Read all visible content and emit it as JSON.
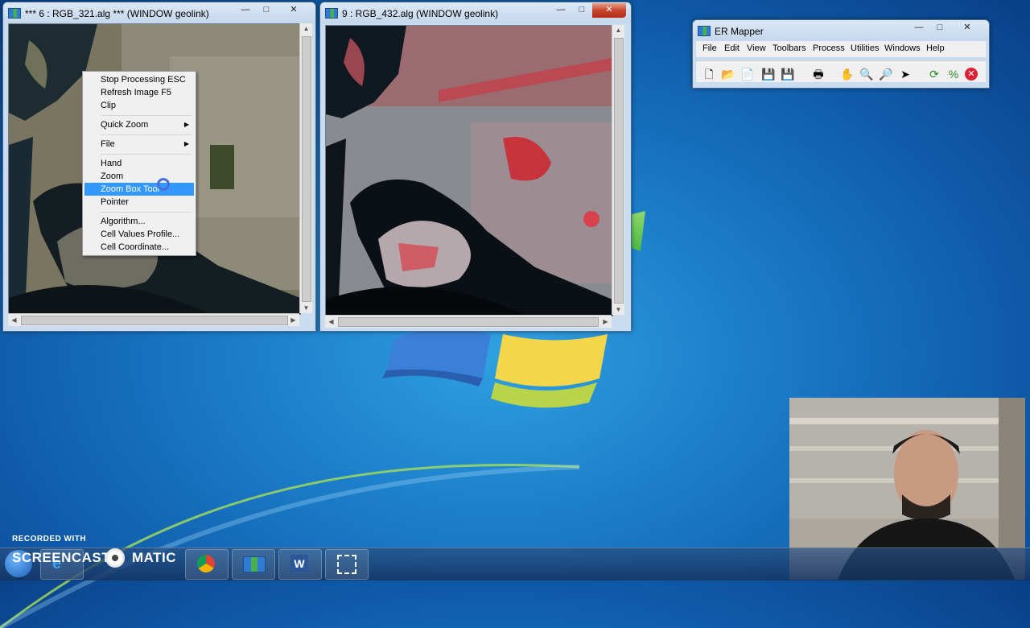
{
  "windows": {
    "left": {
      "title": "*** 6 : RGB_321.alg *** (WINDOW geolink)",
      "minimize": "—",
      "maximize": "□",
      "close": "✕"
    },
    "right": {
      "title": "9 : RGB_432.alg (WINDOW geolink)",
      "minimize": "—",
      "maximize": "□",
      "close": "✕"
    }
  },
  "context_menu": {
    "items": [
      {
        "label": "Stop Processing ESC"
      },
      {
        "label": "Refresh Image F5"
      },
      {
        "label": "Clip"
      },
      {
        "label": "Quick Zoom"
      },
      {
        "label": "File"
      },
      {
        "label": "Hand"
      },
      {
        "label": "Zoom"
      },
      {
        "label": "Zoom Box Tool"
      },
      {
        "label": "Pointer"
      },
      {
        "label": "Algorithm..."
      },
      {
        "label": "Cell Values Profile..."
      },
      {
        "label": "Cell Coordinate..."
      }
    ],
    "submenu_arrow": "▶",
    "selected": "Zoom Box Tool"
  },
  "ermapper": {
    "title": "ER Mapper",
    "menu": [
      "File",
      "Edit",
      "View",
      "Toolbars",
      "Process",
      "Utilities",
      "Windows",
      "Help"
    ],
    "minimize": "—",
    "maximize": "□",
    "close": "✕",
    "toolbar_icons": [
      "new-icon",
      "open-icon",
      "copy-icon",
      "save-icon",
      "save-as-icon",
      "print-icon",
      "hand-icon",
      "zoom-icon",
      "zoom-box-icon",
      "pointer-icon",
      "refresh-icon",
      "percent-icon",
      "stop-icon"
    ]
  },
  "recording": {
    "line1": "RECORDED WITH",
    "line2a": "SCREENCAST",
    "line2b": "MATIC"
  },
  "taskbar": {
    "items": [
      "ie-icon",
      "chrome-icon",
      "ermapper-icon",
      "word-icon",
      "snipping-icon"
    ]
  },
  "colors": {
    "menu_highlight": "#3399ff",
    "close_button": "#c7452b"
  }
}
